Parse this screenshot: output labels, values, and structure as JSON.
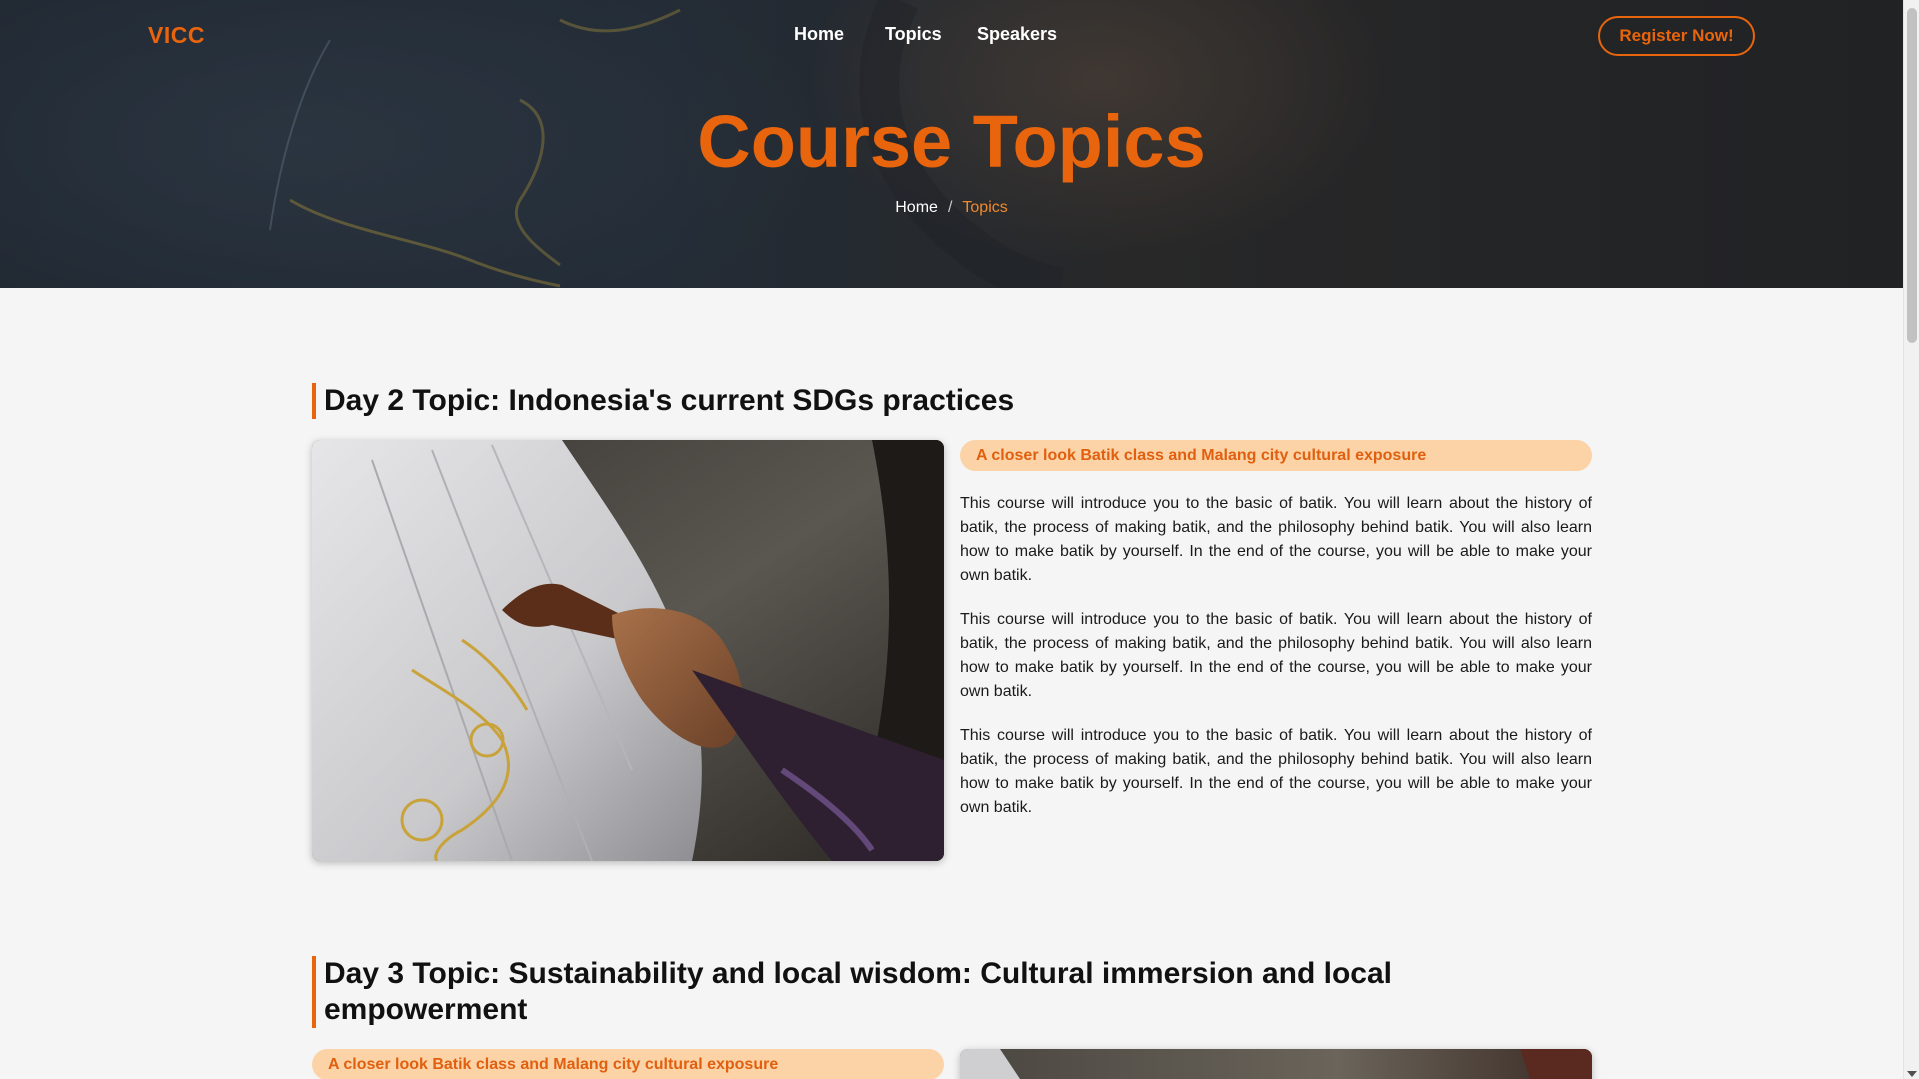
{
  "header": {
    "logo": "VICC",
    "nav": {
      "home": "Home",
      "topics": "Topics",
      "speakers": "Speakers"
    },
    "register_label": "Register Now!"
  },
  "hero": {
    "title": "Course Topics",
    "breadcrumb": {
      "home": "Home",
      "separator": "/",
      "current": "Topics"
    }
  },
  "sections": [
    {
      "title": "Day 2 Topic: Indonesia's current SDGs practices",
      "tag": "A closer look Batik class and Malang city cultural exposure",
      "paragraphs": [
        "This course will introduce you to the basic of batik. You will learn about the history of batik, the process of making batik, and the philosophy behind batik. You will also learn how to make batik by yourself. In the end of the course, you will be able to make your own batik.",
        "This course will introduce you to the basic of batik. You will learn about the history of batik, the process of making batik, and the philosophy behind batik. You will also learn how to make batik by yourself. In the end of the course, you will be able to make your own batik.",
        "This course will introduce you to the basic of batik. You will learn about the history of batik, the process of making batik, and the philosophy behind batik. You will also learn how to make batik by yourself. In the end of the course, you will be able to make your own batik."
      ]
    },
    {
      "title": "Day 3 Topic: Sustainability and local wisdom: Cultural immersion and local empowerment",
      "tag": "A closer look Batik class and Malang city cultural exposure"
    }
  ],
  "colors": {
    "accent": "#e8650d",
    "pill_bg": "#fcd3a6",
    "background": "#f5f5f5"
  }
}
